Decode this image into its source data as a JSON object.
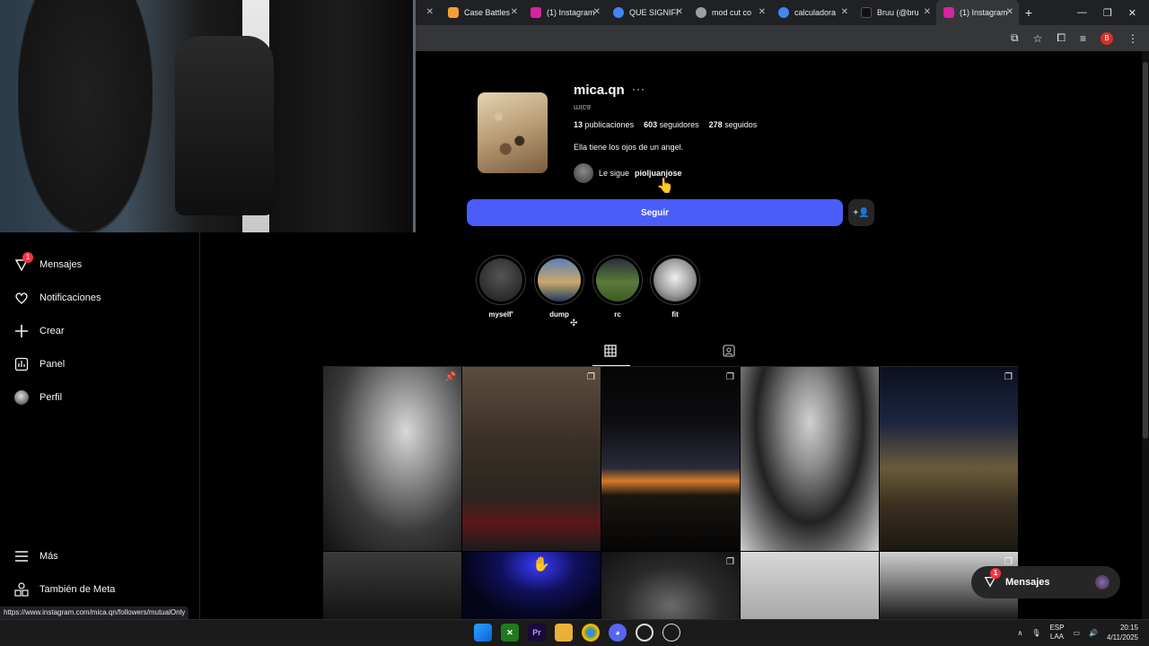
{
  "browser": {
    "tabs": [
      {
        "title": "Case Battles",
        "favicon_color": "#f0a030"
      },
      {
        "title": "(1) Instagram",
        "favicon_color": "#d6249f"
      },
      {
        "title": "QUE SIGNIFI",
        "favicon_color": "#4285f4"
      },
      {
        "title": "mod cut co",
        "favicon_color": "#9aa0a6"
      },
      {
        "title": "calculadora",
        "favicon_color": "#4285f4"
      },
      {
        "title": "Bruu (@bru",
        "favicon_color": "#111111"
      },
      {
        "title": "(1) Instagram",
        "favicon_color": "#d6249f"
      }
    ],
    "new_tab": "+",
    "profile_badge": "B",
    "status_url": "https://www.instagram.com/mica.qn/followers/mutualOnly"
  },
  "sidebar": {
    "items": [
      {
        "label": "Mensajes",
        "icon": "messenger-icon",
        "badge": "1"
      },
      {
        "label": "Notificaciones",
        "icon": "heart-icon"
      },
      {
        "label": "Crear",
        "icon": "plus-icon"
      },
      {
        "label": "Panel",
        "icon": "chart-icon"
      },
      {
        "label": "Perfil",
        "icon": "avatar-icon"
      },
      {
        "label": "Más",
        "icon": "hamburger-icon"
      },
      {
        "label": "También de Meta",
        "icon": "meta-icon"
      }
    ]
  },
  "profile": {
    "username": "mica.qn",
    "more": "···",
    "full_name": "mica",
    "posts_count": "13",
    "posts_label": "publicaciones",
    "followers_count": "603",
    "followers_label": "seguidores",
    "following_count": "278",
    "following_label": "seguidos",
    "bio": "Ella tiene los ojos de un angel.",
    "mutual_prefix": "Le sigue",
    "mutual_user": "pioljuanjose",
    "follow_button": "Seguir",
    "suggest_button": "+👤"
  },
  "highlights": [
    {
      "label": "myself'",
      "color": "#2a2a2a"
    },
    {
      "label": "dump",
      "color": "#3c5a8a"
    },
    {
      "label": "rc",
      "color": "#4a6a2a"
    },
    {
      "label": "fit",
      "color": "#cfcfcf"
    }
  ],
  "messages_float": {
    "label": "Mensajes",
    "badge": "1"
  },
  "taskbar": {
    "lang_top": "ESP",
    "lang_bottom": "LAA",
    "time": "20:15",
    "date": "4/11/2025"
  },
  "colors": {
    "accent": "#4a5df9",
    "notification": "#ff3040",
    "background": "#000000"
  }
}
